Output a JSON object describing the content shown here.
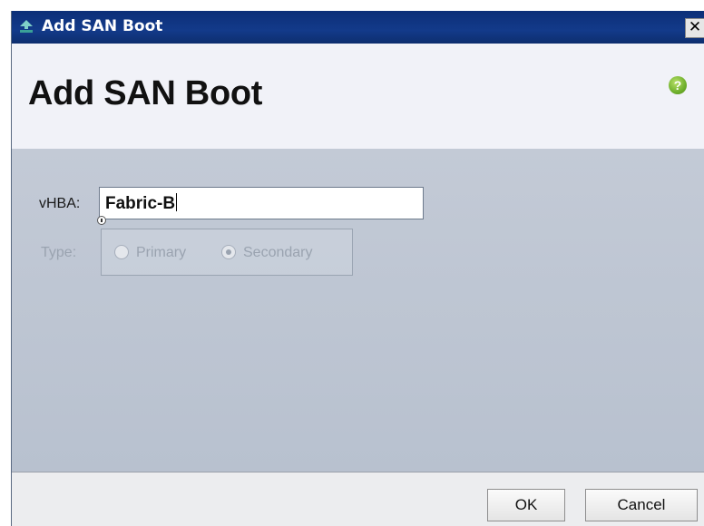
{
  "window": {
    "title": "Add SAN Boot",
    "close_glyph": "✕"
  },
  "header": {
    "title": "Add SAN Boot",
    "help_glyph": "?"
  },
  "form": {
    "vhba": {
      "label": "vHBA:",
      "value": "Fabric-B"
    },
    "type": {
      "label": "Type:",
      "enabled": false,
      "options": [
        {
          "label": "Primary",
          "selected": false
        },
        {
          "label": "Secondary",
          "selected": true
        }
      ]
    }
  },
  "buttons": {
    "ok": "OK",
    "cancel": "Cancel"
  },
  "icons": {
    "title_icon": "ucs-app-icon",
    "help_icon": "help-icon"
  },
  "colors": {
    "titlebar": "#0c2f78",
    "header_bg": "#f1f2f8",
    "body_bg": "#c3cad6",
    "help_green": "#6fb02c"
  }
}
